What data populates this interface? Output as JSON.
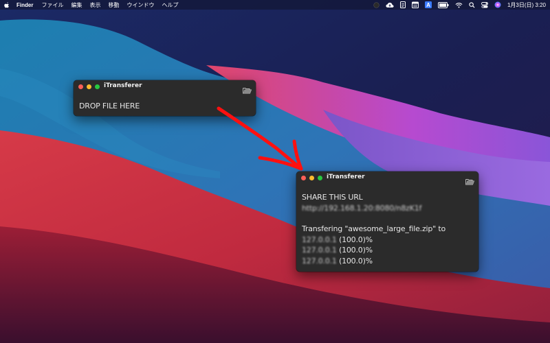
{
  "menubar": {
    "app_name": "Finder",
    "menus": [
      "ファイル",
      "編集",
      "表示",
      "移動",
      "ウインドウ",
      "ヘルプ"
    ],
    "datetime": "1月3日(日)  3:20"
  },
  "window_drop": {
    "title": "iTransferer",
    "drop_label": "DROP FILE HERE"
  },
  "window_share": {
    "title": "iTransferer",
    "share_label": "SHARE THIS URL",
    "url": "http://192.168.1.20:8080/n8zK1f",
    "transfer_line": "Transfering \"awesome_large_file.zip\" to",
    "destinations": [
      {
        "host": "127.0.0.1",
        "progress": "(100.0)%"
      },
      {
        "host": "127.0.0.1",
        "progress": "(100.0)%"
      },
      {
        "host": "127.0.0.1",
        "progress": "(100.0)%"
      }
    ]
  },
  "colors": {
    "window_bg": "#2b2b2b",
    "arrow": "#ff1010",
    "close": "#fe5f57",
    "minimize": "#febc2e",
    "maximize": "#28c840"
  },
  "icons": [
    "apple-icon",
    "folder-open-icon",
    "creative-cloud-icon",
    "wifi-icon",
    "search-icon",
    "control-center-icon",
    "siri-icon",
    "battery-icon"
  ]
}
